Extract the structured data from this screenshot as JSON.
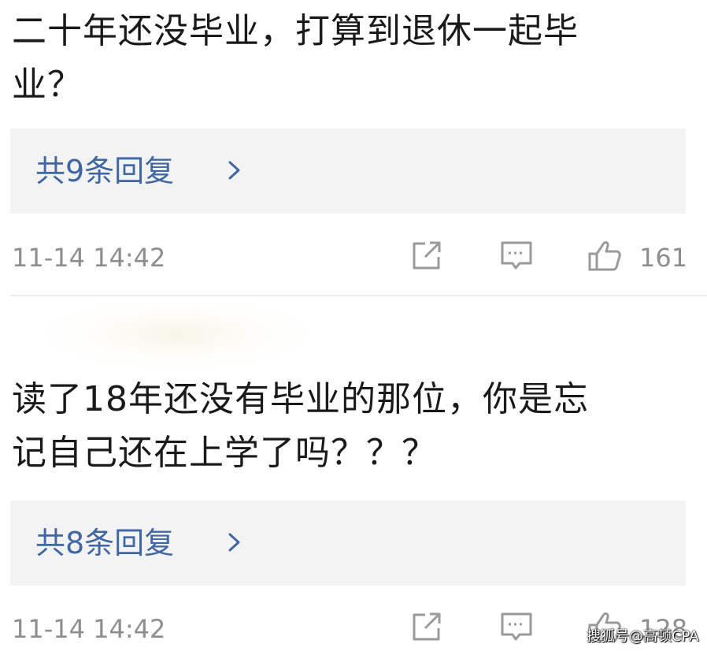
{
  "comments": [
    {
      "text_line1": "二十年还没毕业，打算到退休一起毕",
      "text_line2": "业？",
      "reply_label": "共9条回复",
      "timestamp": "11-14 14:42",
      "like_count": "161"
    },
    {
      "text_line1": "读了18年还没有毕业的那位，你是忘",
      "text_line2": "记自己还在上学了吗？？？",
      "reply_label": "共8条回复",
      "timestamp": "11-14 14:42",
      "like_count": "128"
    }
  ],
  "icons": {
    "share": "share-icon",
    "comment": "comment-icon",
    "like": "thumbs-up-icon",
    "chevron": "chevron-right-icon"
  },
  "colors": {
    "reply_link": "#3f67a3",
    "reply_box_bg": "#f3f3f3",
    "meta_text": "#8e8e8e",
    "body_text": "#1a1a1a"
  },
  "watermark": "搜狐号@高顿CPA"
}
